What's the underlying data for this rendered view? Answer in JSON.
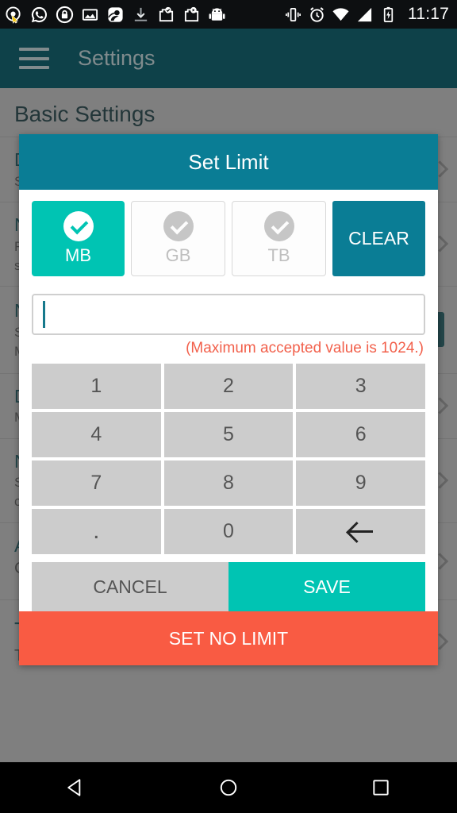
{
  "statusbar": {
    "time": "11:17",
    "left_icons": [
      "search-cursor-icon",
      "whatsapp-icon",
      "lock-icon",
      "image-icon",
      "contact-icon",
      "download-icon",
      "app-update-icon",
      "app-store-icon",
      "android-icon"
    ],
    "right_icons": [
      "vibrate-icon",
      "alarm-icon",
      "wifi-icon",
      "signal-icon",
      "battery-charging-icon"
    ]
  },
  "appbar": {
    "menu_icon": "hamburger-icon",
    "title": "Settings"
  },
  "background": {
    "section_title": "Basic Settings",
    "rows": [
      {
        "title": "D",
        "subtitle": "S",
        "accessory": "chevron"
      },
      {
        "title": "N",
        "subtitle": "F",
        "subtitle2": "s",
        "accessory": "chevron"
      },
      {
        "title": "N",
        "subtitle": "S",
        "subtitle2": "M",
        "accessory": "toggle"
      },
      {
        "title": "D",
        "subtitle": "M",
        "accessory": "chevron"
      },
      {
        "title": "N",
        "subtitle": "S",
        "subtitle2": "c",
        "accessory": "chevron"
      },
      {
        "title": "Apps",
        "subtitle": "Click to Add/Remove from exclusion list of optimization",
        "accessory": "chevron"
      },
      {
        "title": "Tutorial",
        "subtitle": "To display application highlights",
        "accessory": "chevron"
      }
    ]
  },
  "dialog": {
    "title": "Set Limit",
    "units": [
      {
        "label": "MB",
        "selected": true
      },
      {
        "label": "GB",
        "selected": false
      },
      {
        "label": "TB",
        "selected": false
      }
    ],
    "clear_label": "CLEAR",
    "input": {
      "value": "",
      "placeholder": ""
    },
    "max_hint": "(Maximum accepted value is 1024.)",
    "keypad": [
      "1",
      "2",
      "3",
      "4",
      "5",
      "6",
      "7",
      "8",
      "9",
      ".",
      "0",
      "backspace-icon"
    ],
    "cancel_label": "CANCEL",
    "save_label": "SAVE",
    "no_limit_label": "SET NO LIMIT"
  },
  "navbar": {
    "back": "back-triangle-icon",
    "home": "home-circle-icon",
    "recents": "recents-square-icon"
  },
  "colors": {
    "appbar": "#0e4149",
    "dialog_header": "#0a7d95",
    "accent_teal": "#00c4b3",
    "clear_teal": "#0a7d95",
    "danger_red": "#f95b43",
    "hint_red": "#f2604b",
    "key_gray": "#cccccc",
    "section_title": "#0e4149"
  }
}
